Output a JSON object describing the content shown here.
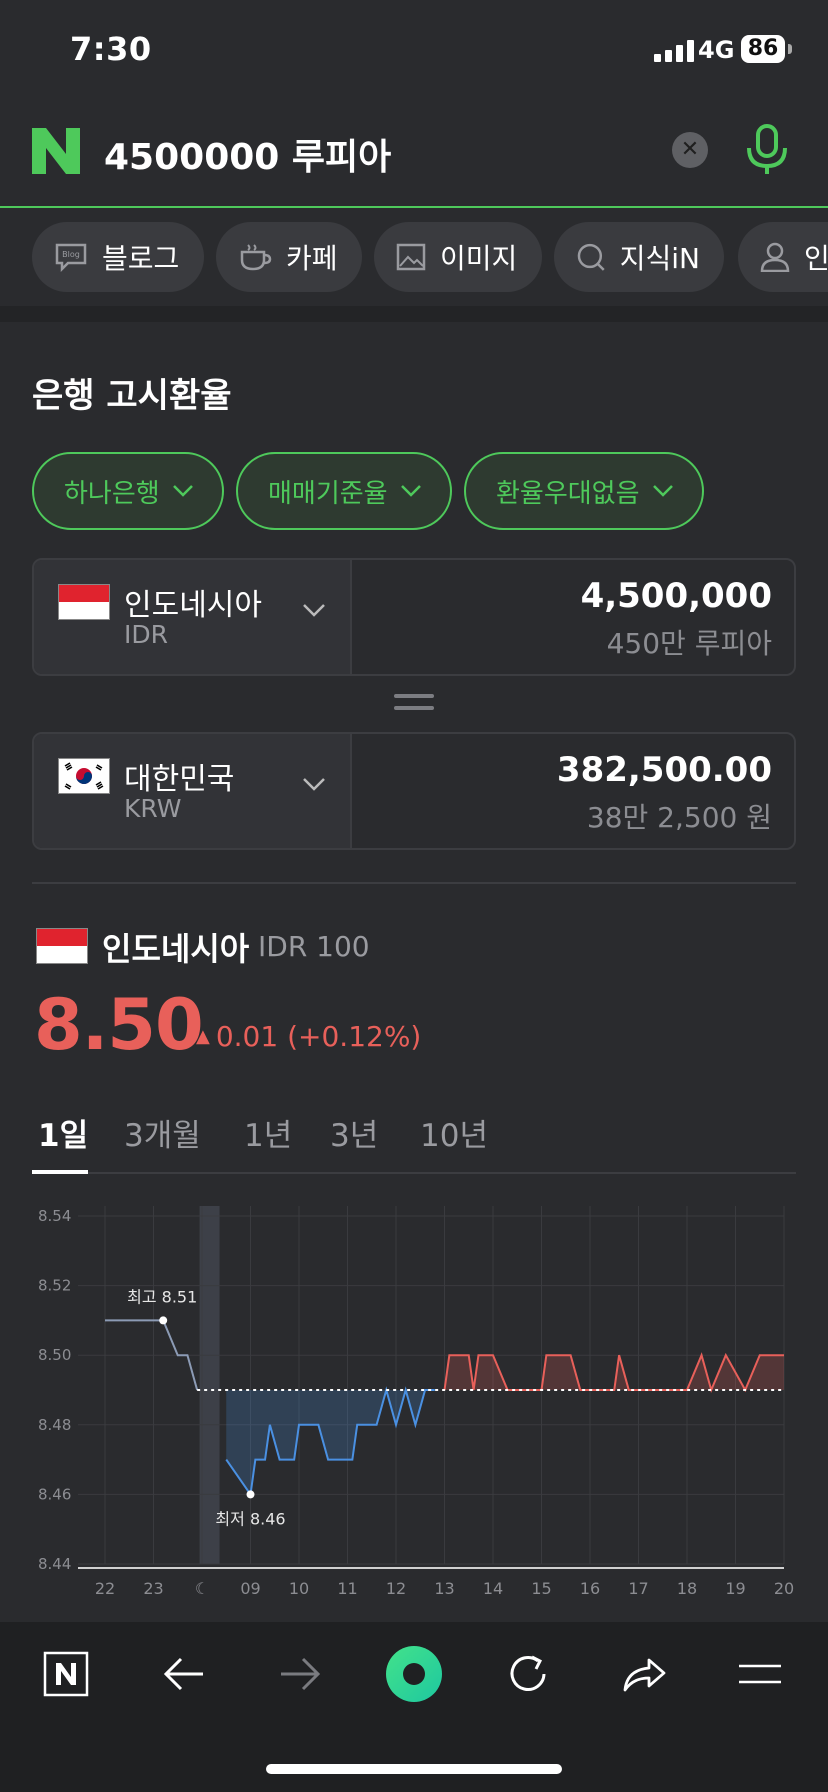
{
  "status": {
    "time": "7:30",
    "network": "4G",
    "battery": "86"
  },
  "search": {
    "query": "4500000 루피아"
  },
  "chips": [
    {
      "label": "블로그",
      "icon": "blog-icon"
    },
    {
      "label": "카페",
      "icon": "cafe-cup-icon"
    },
    {
      "label": "이미지",
      "icon": "image-icon"
    },
    {
      "label": "지식iN",
      "icon": "knowledge-in-icon"
    },
    {
      "label": "인",
      "icon": "person-icon"
    }
  ],
  "section_title": "은행 고시환율",
  "filters": {
    "bank": "하나은행",
    "rate_type": "매매기준율",
    "preference": "환율우대없음"
  },
  "converter": {
    "from": {
      "country": "인도네시아",
      "code": "IDR",
      "amount": "4,500,000",
      "amount_words": "450만 루피아"
    },
    "to": {
      "country": "대한민국",
      "code": "KRW",
      "amount": "382,500.00",
      "amount_words": "38만 2,500 원"
    }
  },
  "rate": {
    "country": "인도네시아",
    "unit": "IDR 100",
    "value": "8.50",
    "change": "0.01 (+0.12%)",
    "up_color": "#e8605a",
    "down_color": "#4a90e2"
  },
  "tabs": [
    "1일",
    "3개월",
    "1년",
    "3년",
    "10년"
  ],
  "chart_data": {
    "type": "line",
    "y_ticks": [
      "8.54",
      "8.52",
      "8.50",
      "8.48",
      "8.46",
      "8.44"
    ],
    "x_ticks": [
      "22",
      "23",
      "☾",
      "09",
      "10",
      "11",
      "12",
      "13",
      "14",
      "15",
      "16",
      "17",
      "18",
      "19",
      "20"
    ],
    "ylim": [
      8.44,
      8.54
    ],
    "baseline": 8.49,
    "high_label": "최고 8.51",
    "low_label": "최저 8.46",
    "series": [
      {
        "segment": "overnight",
        "color": "#8c9bb5",
        "points": [
          [
            0,
            8.51
          ],
          [
            1.2,
            8.51
          ],
          [
            1.5,
            8.5
          ],
          [
            1.7,
            8.5
          ],
          [
            1.9,
            8.49
          ]
        ]
      },
      {
        "segment": "down",
        "color": "#4a90e2",
        "points": [
          [
            2.5,
            8.47
          ],
          [
            3.0,
            8.46
          ],
          [
            3.1,
            8.47
          ],
          [
            3.3,
            8.47
          ],
          [
            3.4,
            8.48
          ],
          [
            3.6,
            8.47
          ],
          [
            3.9,
            8.47
          ],
          [
            4.0,
            8.48
          ],
          [
            4.4,
            8.48
          ],
          [
            4.6,
            8.47
          ],
          [
            5.1,
            8.47
          ],
          [
            5.2,
            8.48
          ],
          [
            5.6,
            8.48
          ],
          [
            5.8,
            8.49
          ],
          [
            6.0,
            8.48
          ],
          [
            6.2,
            8.49
          ],
          [
            6.4,
            8.48
          ],
          [
            6.6,
            8.49
          ],
          [
            6.8,
            8.49
          ]
        ]
      },
      {
        "segment": "up",
        "color": "#e8605a",
        "points": [
          [
            7.0,
            8.49
          ],
          [
            7.1,
            8.5
          ],
          [
            7.5,
            8.5
          ],
          [
            7.6,
            8.49
          ],
          [
            7.7,
            8.5
          ],
          [
            8.0,
            8.5
          ],
          [
            8.3,
            8.49
          ],
          [
            9.0,
            8.49
          ],
          [
            9.1,
            8.5
          ],
          [
            9.6,
            8.5
          ],
          [
            9.8,
            8.49
          ],
          [
            10.5,
            8.49
          ],
          [
            10.6,
            8.5
          ],
          [
            10.8,
            8.49
          ],
          [
            12.0,
            8.49
          ],
          [
            12.3,
            8.5
          ],
          [
            12.5,
            8.49
          ],
          [
            12.8,
            8.5
          ],
          [
            13.2,
            8.49
          ],
          [
            13.5,
            8.5
          ],
          [
            14.0,
            8.5
          ]
        ]
      }
    ]
  }
}
